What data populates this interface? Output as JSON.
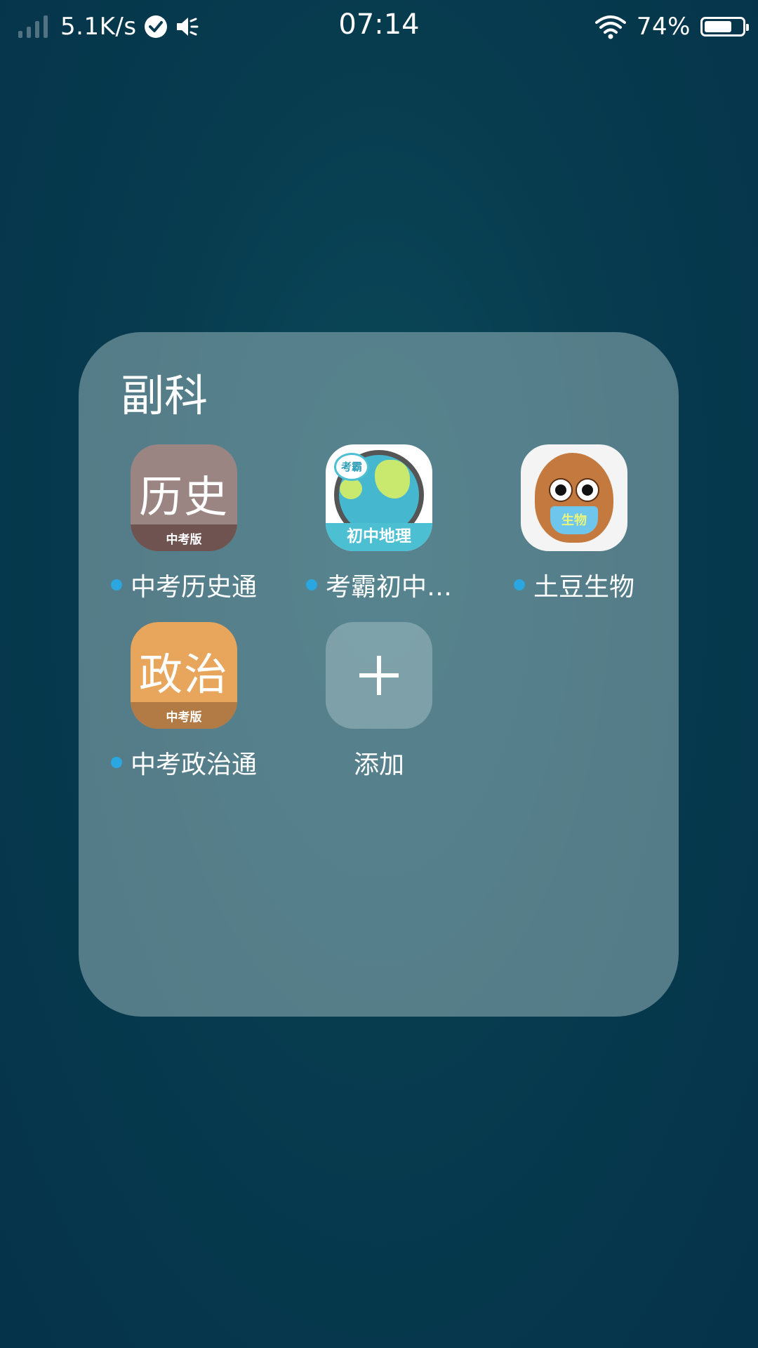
{
  "status_bar": {
    "network_speed": "5.1K/s",
    "time": "07:14",
    "battery": "74%",
    "battery_level": 0.74,
    "icons": [
      "signal-icon",
      "check-circle-icon",
      "mute-icon",
      "wifi-icon",
      "battery-icon"
    ]
  },
  "folder": {
    "title": "副科",
    "apps": [
      {
        "label": "中考历史通",
        "icon_text": "历史",
        "icon_subtext": "中考版",
        "has_update_dot": true
      },
      {
        "label": "考霸初中…",
        "icon_bubble_text": "考霸",
        "icon_band_text": "初中地理",
        "has_update_dot": true
      },
      {
        "label": "土豆生物",
        "icon_text": "生物",
        "has_update_dot": true
      },
      {
        "label": "中考政治通",
        "icon_text": "政治",
        "icon_subtext": "中考版",
        "has_update_dot": true
      }
    ],
    "add": {
      "label": "添加"
    }
  },
  "colors": {
    "background": "#073b4e",
    "update_dot": "#2aa6e0",
    "history_icon": "#9a8582",
    "politics_icon": "#e8a55c"
  }
}
